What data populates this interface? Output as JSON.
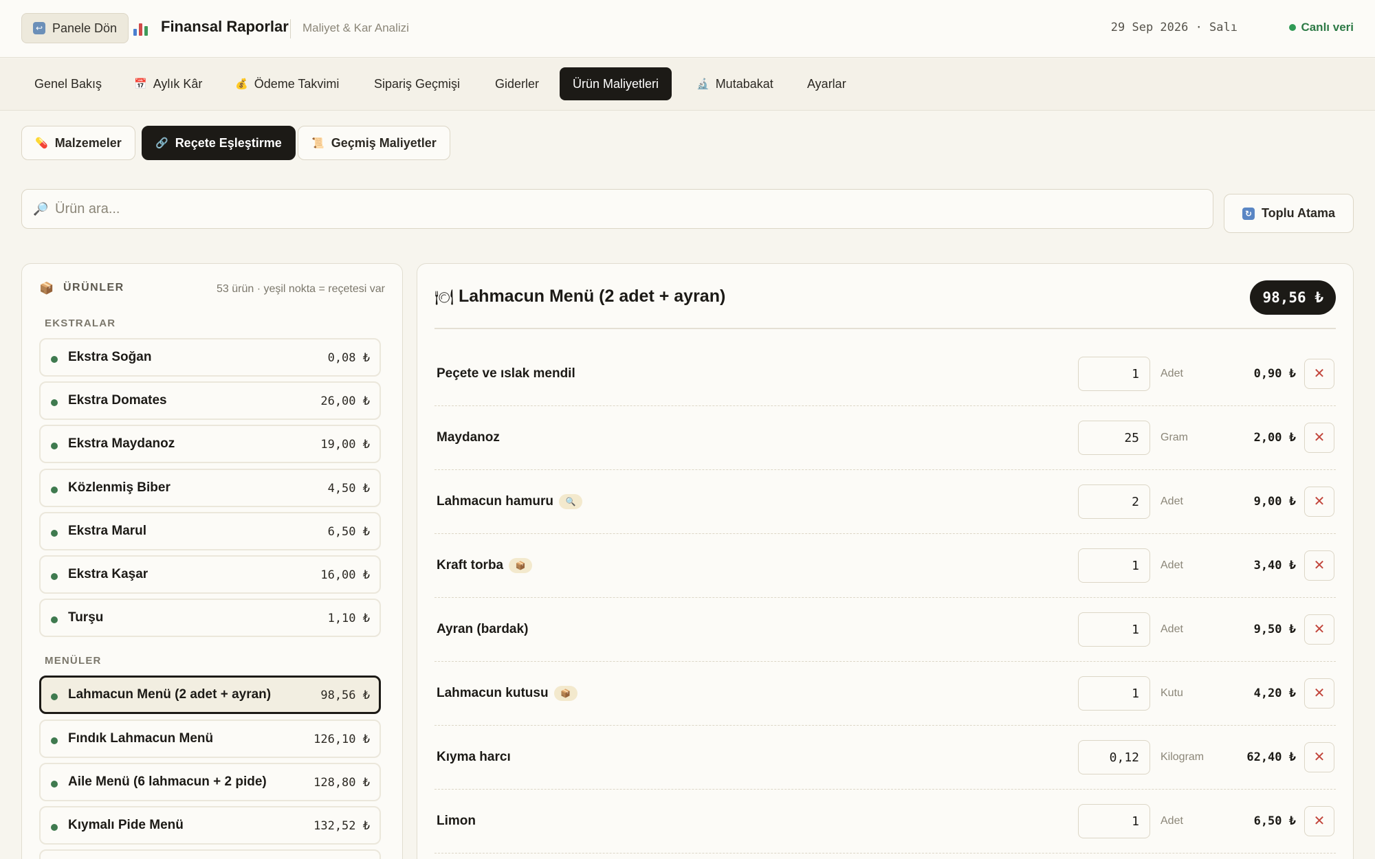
{
  "header": {
    "back_label": "Panele Dön",
    "title": "Finansal Raporlar",
    "subtitle": "Maliyet & Kar Analizi",
    "date": "29 Sep 2026 · Salı",
    "live_label": "Canlı veri"
  },
  "nav": {
    "tabs": [
      {
        "label": "Genel Bakış",
        "icon": ""
      },
      {
        "label": "Aylık Kâr",
        "icon": "calendar-icon"
      },
      {
        "label": "Ödeme Takvimi",
        "icon": "money-bag-icon"
      },
      {
        "label": "Sipariş Geçmişi",
        "icon": ""
      },
      {
        "label": "Giderler",
        "icon": ""
      },
      {
        "label": "Ürün Maliyetleri",
        "icon": "",
        "active": true
      },
      {
        "label": "Mutabakat",
        "icon": "microscope-icon"
      },
      {
        "label": "Ayarlar",
        "icon": ""
      }
    ]
  },
  "subtabs": [
    {
      "label": "Malzemeler",
      "icon": "pill-icon"
    },
    {
      "label": "Reçete Eşleştirme",
      "icon": "link-icon",
      "active": true
    },
    {
      "label": "Geçmiş Maliyetler",
      "icon": "scroll-icon"
    }
  ],
  "search": {
    "placeholder": "Ürün ara...",
    "value": ""
  },
  "bulk_button": {
    "label": "Toplu Atama"
  },
  "products_panel": {
    "heading": "ÜRÜNLER",
    "count_text": "53 ürün · yeşil nokta = reçetesi var",
    "groups": [
      {
        "label": "EKSTRALAR",
        "items": [
          {
            "name": "Ekstra Soğan",
            "price": "0,08 ₺"
          },
          {
            "name": "Ekstra Domates",
            "price": "26,00 ₺"
          },
          {
            "name": "Ekstra Maydanoz",
            "price": "19,00 ₺"
          },
          {
            "name": "Közlenmiş Biber",
            "price": "4,50 ₺"
          },
          {
            "name": "Ekstra Marul",
            "price": "6,50 ₺"
          },
          {
            "name": "Ekstra Kaşar",
            "price": "16,00 ₺"
          },
          {
            "name": "Turşu",
            "price": "1,10 ₺"
          }
        ]
      },
      {
        "label": "MENÜLER",
        "items": [
          {
            "name": "Lahmacun Menü (2 adet + ayran)",
            "price": "98,56 ₺",
            "selected": true
          },
          {
            "name": "Fındık Lahmacun Menü",
            "price": "126,10 ₺"
          },
          {
            "name": "Aile Menü (6 lahmacun + 2 pide)",
            "price": "128,80 ₺"
          },
          {
            "name": "Kıymalı Pide Menü",
            "price": "132,52 ₺"
          }
        ]
      }
    ]
  },
  "recipe": {
    "title": "Lahmacun Menü (2 adet + ayran)",
    "total": "98,56 ₺",
    "ingredients": [
      {
        "name": "Peçete ve ıslak mendil",
        "qty": "1",
        "unit": "Adet",
        "cost": "0,90 ₺",
        "tag": ""
      },
      {
        "name": "Maydanoz",
        "qty": "25",
        "unit": "Gram",
        "cost": "2,00 ₺",
        "tag": ""
      },
      {
        "name": "Lahmacun hamuru",
        "qty": "2",
        "unit": "Adet",
        "cost": "9,00 ₺",
        "tag": "magnifier-icon"
      },
      {
        "name": "Kraft torba",
        "qty": "1",
        "unit": "Adet",
        "cost": "3,40 ₺",
        "tag": "package-icon"
      },
      {
        "name": "Ayran (bardak)",
        "qty": "1",
        "unit": "Adet",
        "cost": "9,50 ₺",
        "tag": ""
      },
      {
        "name": "Lahmacun kutusu",
        "qty": "1",
        "unit": "Kutu",
        "cost": "4,20 ₺",
        "tag": "package-icon"
      },
      {
        "name": "Kıyma harcı",
        "qty": "0,12",
        "unit": "Kilogram",
        "cost": "62,40 ₺",
        "tag": ""
      },
      {
        "name": "Limon",
        "qty": "1",
        "unit": "Adet",
        "cost": "6,50 ₺",
        "tag": ""
      }
    ]
  },
  "colors": {
    "background": "#f7f5ee",
    "accent_dark": "#1c1a16",
    "live_green": "#2d7a46",
    "recipe_dot": "#3f7a4f",
    "delete_red": "#c2463c"
  }
}
